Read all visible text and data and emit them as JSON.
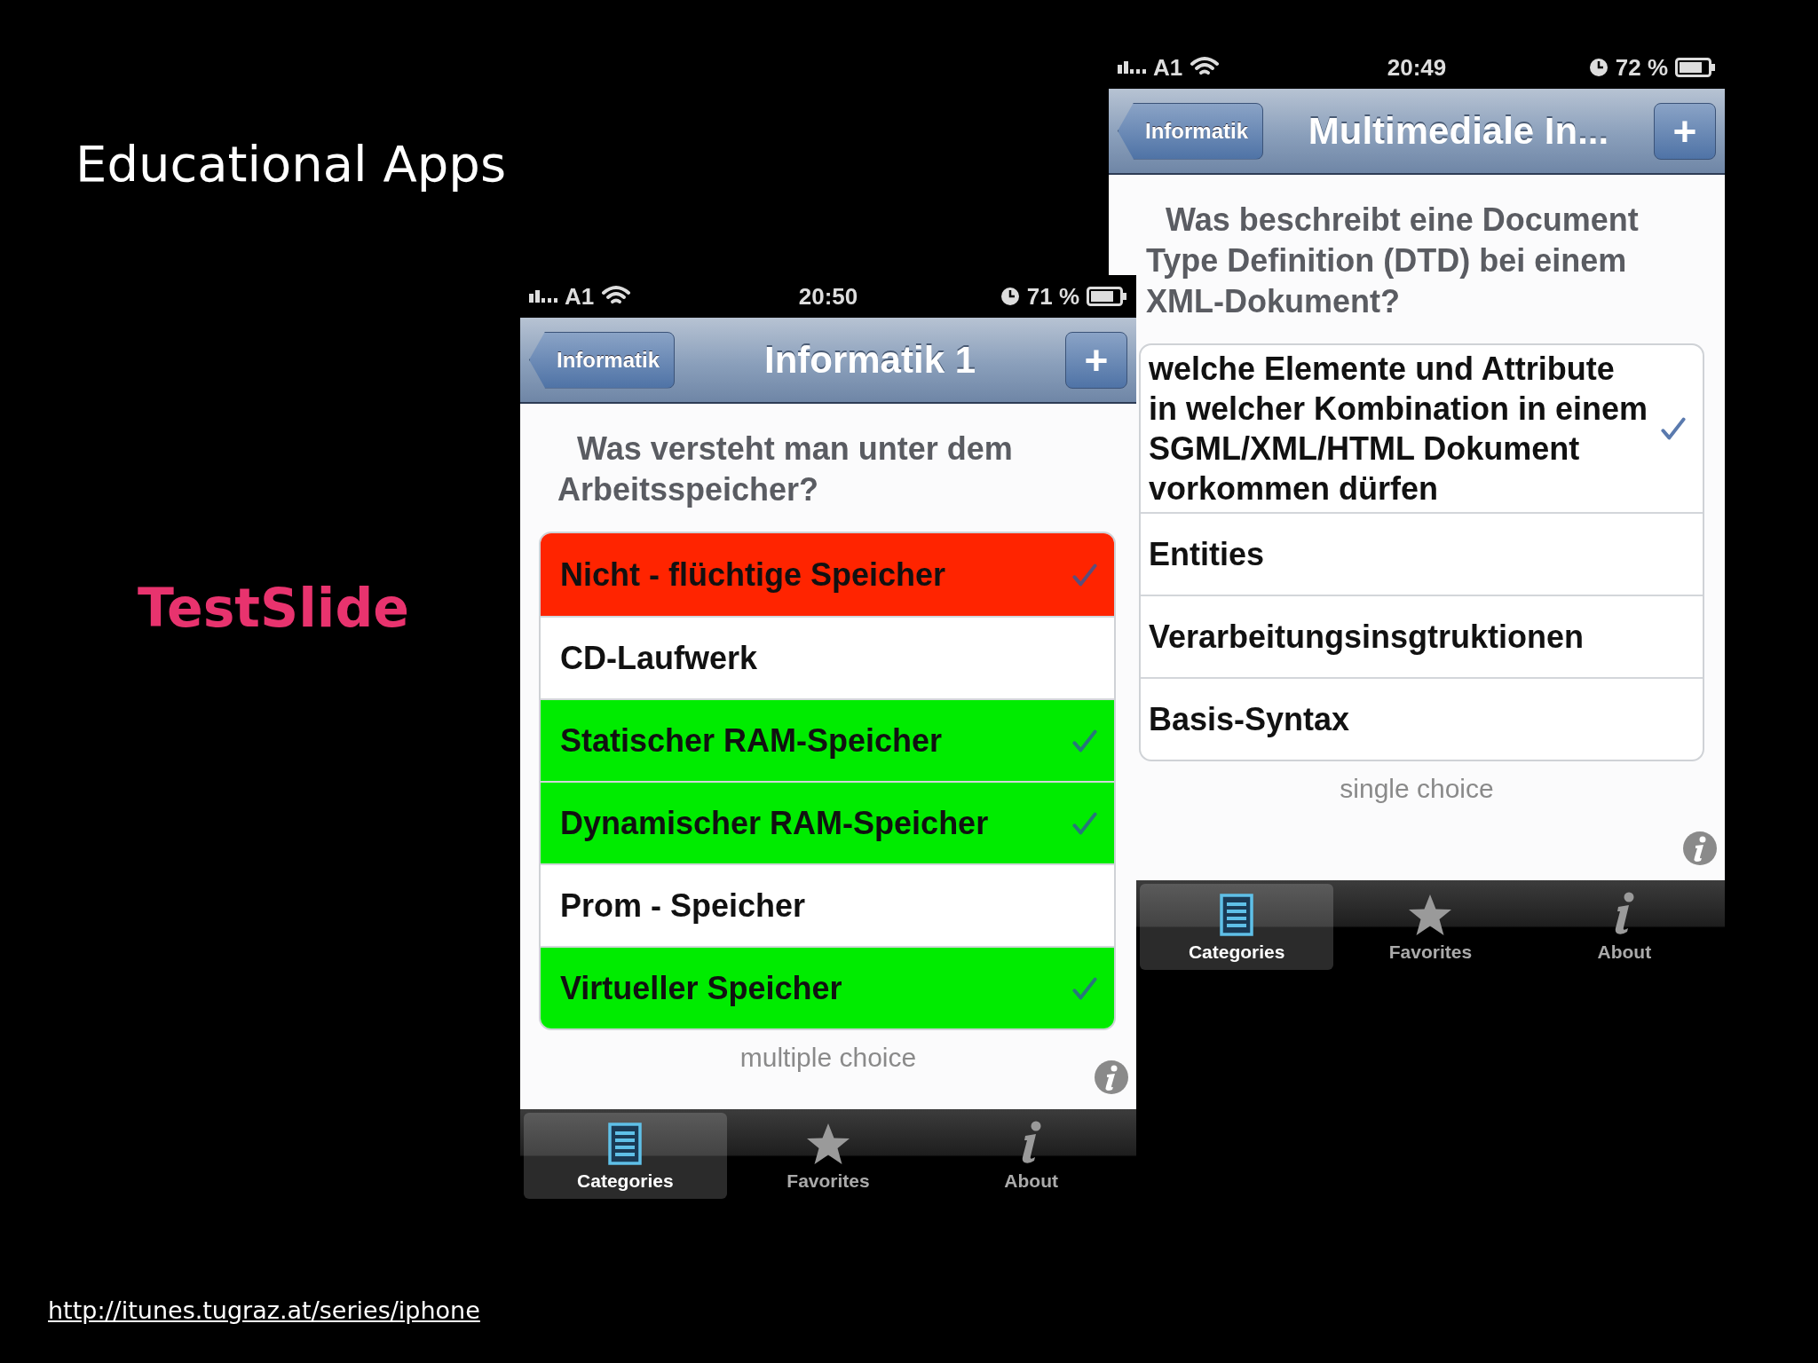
{
  "slide": {
    "title": "Educational Apps",
    "subtitle": "TestSlide",
    "link": "http://itunes.tugraz.at/series/iphone"
  },
  "phones": [
    {
      "status": {
        "carrier": "A1",
        "time": "20:49",
        "battery": "72 %"
      },
      "nav": {
        "back": "Informatik",
        "title": "Multimediale In...",
        "add": "+"
      },
      "question": "Was beschreibt eine Document Type Definition (DTD) bei einem XML-Dokument?",
      "options": [
        {
          "text": "welche Elemente und Attribute in welcher Kombination in einem SGML/XML/HTML Dokument vorkommen dürfen",
          "checked": true
        },
        {
          "text": "Entities",
          "checked": false
        },
        {
          "text": "Verarbeitungsinsgtruktionen",
          "checked": false
        },
        {
          "text": "Basis-Syntax",
          "checked": false
        }
      ],
      "choice_type": "single choice",
      "tabs": [
        {
          "label": "Categories",
          "kind": "list",
          "selected": true
        },
        {
          "label": "Favorites",
          "kind": "star",
          "selected": false
        },
        {
          "label": "About",
          "kind": "info",
          "selected": false
        }
      ]
    },
    {
      "status": {
        "carrier": "A1",
        "time": "20:50",
        "battery": "71 %"
      },
      "nav": {
        "back": "Informatik",
        "title": "Informatik 1",
        "add": "+"
      },
      "question": "Was versteht man unter dem Arbeitsspeicher?",
      "options": [
        {
          "text": "Nicht - flüchtige Speicher",
          "color": "#ff2400",
          "checked": true
        },
        {
          "text": "CD-Laufwerk",
          "color": "#ffffff",
          "checked": false
        },
        {
          "text": "Statischer RAM-Speicher",
          "color": "#00ec00",
          "checked": true
        },
        {
          "text": "Dynamischer RAM-Speicher",
          "color": "#00ec00",
          "checked": true
        },
        {
          "text": "Prom - Speicher",
          "color": "#ffffff",
          "checked": false
        },
        {
          "text": "Virtueller Speicher",
          "color": "#00ec00",
          "checked": true
        }
      ],
      "choice_type": "multiple choice",
      "tabs": [
        {
          "label": "Categories",
          "kind": "list",
          "selected": true
        },
        {
          "label": "Favorites",
          "kind": "star",
          "selected": false
        },
        {
          "label": "About",
          "kind": "info",
          "selected": false
        }
      ]
    }
  ]
}
